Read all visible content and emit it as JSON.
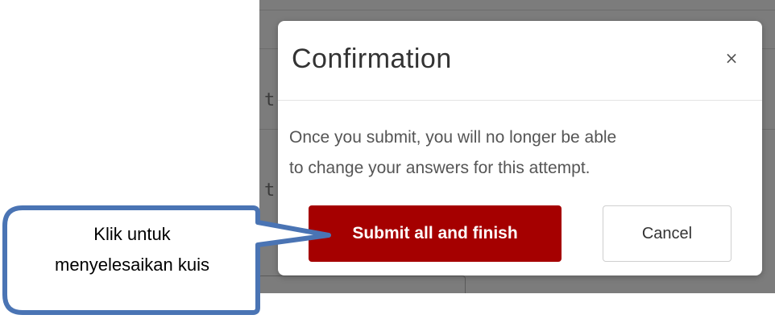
{
  "background": {
    "fragments": [
      "t",
      "t"
    ]
  },
  "modal": {
    "title": "Confirmation",
    "close_glyph": "×",
    "body_lines": [
      "Once you submit, you will no longer be able",
      "to change your answers for this attempt."
    ],
    "submit_label": "Submit all and finish",
    "cancel_label": "Cancel"
  },
  "callout": {
    "lines": [
      "Klik untuk",
      "menyelesaikan kuis"
    ]
  },
  "colors": {
    "submit_bg": "#a50000",
    "callout_border": "#4a74b4",
    "overlay": "#7c7c7c"
  }
}
